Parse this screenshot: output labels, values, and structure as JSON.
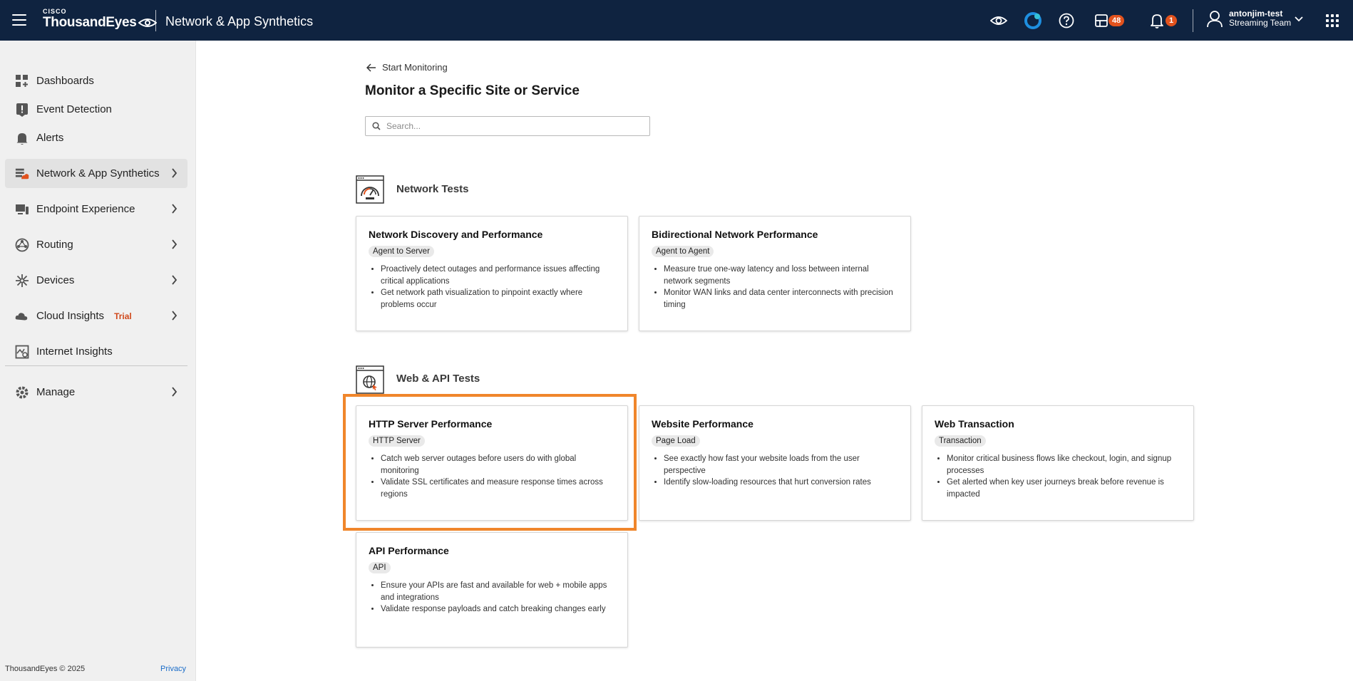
{
  "header": {
    "brand_small": "CISCO",
    "brand": "ThousandEyes",
    "product": "Network & App Synthetics",
    "badges": {
      "dashboards": "48",
      "notifications": "1"
    },
    "user": {
      "name": "antonjim-test",
      "team": "Streaming Team"
    },
    "icons": [
      "menu-icon",
      "eye-icon",
      "assistant-icon",
      "help-icon",
      "dashboard-icon",
      "bell-icon",
      "user-icon",
      "chevron-down-icon",
      "app-grid-icon"
    ]
  },
  "sidebar": {
    "items": [
      {
        "label": "Dashboards",
        "icon": "dashboards-icon"
      },
      {
        "label": "Event Detection",
        "icon": "event-detection-icon"
      },
      {
        "label": "Alerts",
        "icon": "alerts-icon"
      },
      {
        "label": "Network & App Synthetics",
        "icon": "synthetics-icon",
        "active": true
      },
      {
        "label": "Endpoint Experience",
        "icon": "endpoint-icon"
      },
      {
        "label": "Routing",
        "icon": "routing-icon"
      },
      {
        "label": "Devices",
        "icon": "devices-icon"
      },
      {
        "label": "Cloud Insights",
        "icon": "cloud-icon",
        "tag": "Trial"
      },
      {
        "label": "Internet Insights",
        "icon": "internet-insights-icon"
      },
      {
        "label": "Manage",
        "icon": "manage-icon"
      }
    ],
    "footer": {
      "copyright": "ThousandEyes © 2025",
      "privacy": "Privacy"
    }
  },
  "main": {
    "back_label": "Start Monitoring",
    "title": "Monitor a Specific Site or Service",
    "search_placeholder": "Search...",
    "sections": [
      {
        "title": "Network Tests",
        "cards": [
          {
            "title": "Network Discovery and Performance",
            "chip": "Agent to Server",
            "bullets": [
              "Proactively detect outages and performance issues affecting critical applications",
              "Get network path visualization to pinpoint exactly where problems occur"
            ]
          },
          {
            "title": "Bidirectional Network Performance",
            "chip": "Agent to Agent",
            "bullets": [
              "Measure true one-way latency and loss between internal network segments",
              "Monitor WAN links and data center interconnects with precision timing"
            ]
          }
        ]
      },
      {
        "title": "Web & API Tests",
        "cards": [
          {
            "title": "HTTP Server Performance",
            "chip": "HTTP Server",
            "bullets": [
              "Catch web server outages before users do with global monitoring",
              "Validate SSL certificates and measure response times across regions"
            ]
          },
          {
            "title": "Website Performance",
            "chip": "Page Load",
            "bullets": [
              "See exactly how fast your website loads from the user perspective",
              "Identify slow-loading resources that hurt conversion rates"
            ]
          },
          {
            "title": "Web Transaction",
            "chip": "Transaction",
            "bullets": [
              "Monitor critical business flows like checkout, login, and signup processes",
              "Get alerted when key user journeys break before revenue is impacted"
            ]
          },
          {
            "title": "API Performance",
            "chip": "API",
            "bullets": [
              "Ensure your APIs are fast and available for web + mobile apps and integrations",
              "Validate response payloads and catch breaking changes early"
            ]
          }
        ]
      }
    ]
  },
  "colors": {
    "header_bg": "#0f2340",
    "highlight": "#f0862b",
    "badge": "#e2521d",
    "accent": "#e2521d"
  }
}
